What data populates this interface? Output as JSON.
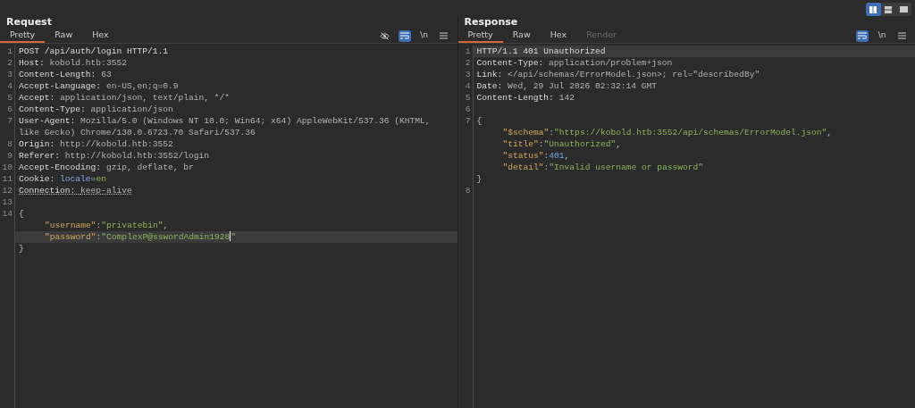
{
  "layout_toggle": [
    {
      "kind": "columns",
      "selected": true
    },
    {
      "kind": "rows",
      "selected": false
    },
    {
      "kind": "single",
      "selected": false
    }
  ],
  "panels": [
    {
      "title": "Request",
      "tabs": [
        {
          "label": "Pretty",
          "selected": true,
          "disabled": false
        },
        {
          "label": "Raw",
          "selected": false,
          "disabled": false
        },
        {
          "label": "Hex",
          "selected": false,
          "disabled": false
        }
      ],
      "toolbar": [
        {
          "kind": "hide",
          "active": false
        },
        {
          "kind": "wrap",
          "active": true
        },
        {
          "kind": "newline",
          "label": "\\n",
          "active": false
        },
        {
          "kind": "menu",
          "active": false
        }
      ],
      "rows": [
        {
          "number": "1",
          "highlighted": false,
          "indented": false,
          "underlined": false,
          "segments": [
            {
              "kind": "plain",
              "text": "POST /api/auth/login HTTP/1.1"
            }
          ]
        },
        {
          "number": "2",
          "highlighted": false,
          "indented": false,
          "underlined": false,
          "segments": [
            {
              "kind": "name",
              "text": "Host: "
            },
            {
              "kind": "value",
              "text": "kobold.htb:3552"
            }
          ]
        },
        {
          "number": "3",
          "highlighted": false,
          "indented": false,
          "underlined": false,
          "segments": [
            {
              "kind": "name",
              "text": "Content-Length: "
            },
            {
              "kind": "value",
              "text": "63"
            }
          ]
        },
        {
          "number": "4",
          "highlighted": false,
          "indented": false,
          "underlined": false,
          "segments": [
            {
              "kind": "name",
              "text": "Accept-Language: "
            },
            {
              "kind": "value",
              "text": "en-US,en;q=0.9"
            }
          ]
        },
        {
          "number": "5",
          "highlighted": false,
          "indented": false,
          "underlined": false,
          "segments": [
            {
              "kind": "name",
              "text": "Accept: "
            },
            {
              "kind": "value",
              "text": "application/json, text/plain, */*"
            }
          ]
        },
        {
          "number": "6",
          "highlighted": false,
          "indented": false,
          "underlined": false,
          "segments": [
            {
              "kind": "name",
              "text": "Content-Type: "
            },
            {
              "kind": "value",
              "text": "application/json"
            }
          ]
        },
        {
          "number": "7",
          "highlighted": false,
          "indented": false,
          "underlined": false,
          "segments": [
            {
              "kind": "name",
              "text": "User-Agent: "
            },
            {
              "kind": "value",
              "text": "Mozilla/5.0 (Windows NT 10.0; Win64; x64) AppleWebKit/537.36 (KHTML,"
            }
          ]
        },
        {
          "highlighted": false,
          "indented": false,
          "underlined": false,
          "segments": [
            {
              "kind": "value",
              "text": "like Gecko) Chrome/130.0.6723.70 Safari/537.36"
            }
          ]
        },
        {
          "number": "8",
          "highlighted": false,
          "indented": false,
          "underlined": false,
          "segments": [
            {
              "kind": "name",
              "text": "Origin: "
            },
            {
              "kind": "value",
              "text": "http://kobold.htb:3552"
            }
          ]
        },
        {
          "number": "9",
          "highlighted": false,
          "indented": false,
          "underlined": false,
          "segments": [
            {
              "kind": "name",
              "text": "Referer: "
            },
            {
              "kind": "value",
              "text": "http://kobold.htb:3552/login"
            }
          ]
        },
        {
          "number": "10",
          "highlighted": false,
          "indented": false,
          "underlined": false,
          "segments": [
            {
              "kind": "name",
              "text": "Accept-Encoding: "
            },
            {
              "kind": "value",
              "text": "gzip, deflate, br"
            }
          ]
        },
        {
          "number": "11",
          "highlighted": false,
          "indented": false,
          "underlined": false,
          "segments": [
            {
              "kind": "name",
              "text": "Cookie: "
            },
            {
              "kind": "param",
              "text": "locale"
            },
            {
              "kind": "punct",
              "text": "="
            },
            {
              "kind": "string",
              "text": "en"
            }
          ]
        },
        {
          "number": "12",
          "highlighted": false,
          "indented": false,
          "underlined": true,
          "segments": [
            {
              "kind": "name",
              "text": "Connection: "
            },
            {
              "kind": "value",
              "text": "keep-alive"
            }
          ]
        },
        {
          "number": "13",
          "segments": []
        },
        {
          "number": "14",
          "highlighted": false,
          "indented": false,
          "segments": [
            {
              "kind": "punct",
              "text": "{"
            }
          ]
        },
        {
          "highlighted": false,
          "indented": true,
          "underlined": false,
          "segments": [
            {
              "kind": "key",
              "text": "\"username\""
            },
            {
              "kind": "punct",
              "text": ":"
            },
            {
              "kind": "string",
              "text": "\"privatebin\""
            },
            {
              "kind": "punct",
              "text": ","
            }
          ]
        },
        {
          "highlighted": true,
          "indented": true,
          "underlined": false,
          "cursor": true,
          "segments": [
            {
              "kind": "key",
              "text": "\"password\""
            },
            {
              "kind": "punct",
              "text": ":"
            },
            {
              "kind": "string",
              "text": "\"ComplexP@sswordAdmin1928"
            },
            {
              "kind": "string",
              "text": "\""
            }
          ]
        },
        {
          "highlighted": false,
          "indented": false,
          "segments": [
            {
              "kind": "punct",
              "text": "}"
            }
          ]
        }
      ]
    },
    {
      "title": "Response",
      "tabs": [
        {
          "label": "Pretty",
          "selected": true,
          "disabled": false
        },
        {
          "label": "Raw",
          "selected": false,
          "disabled": false
        },
        {
          "label": "Hex",
          "selected": false,
          "disabled": false
        },
        {
          "label": "Render",
          "selected": false,
          "disabled": true
        }
      ],
      "toolbar": [
        {
          "kind": "wrap",
          "active": true
        },
        {
          "kind": "newline",
          "label": "\\n",
          "active": false
        },
        {
          "kind": "menu",
          "active": false
        }
      ],
      "rows": [
        {
          "number": "1",
          "highlighted": true,
          "indented": false,
          "underlined": false,
          "segments": [
            {
              "kind": "plain",
              "text": "HTTP/1.1 401 Unauthorized"
            }
          ]
        },
        {
          "number": "2",
          "highlighted": false,
          "indented": false,
          "underlined": false,
          "segments": [
            {
              "kind": "name",
              "text": "Content-Type: "
            },
            {
              "kind": "value",
              "text": "application/problem+json"
            }
          ]
        },
        {
          "number": "3",
          "highlighted": false,
          "indented": false,
          "underlined": false,
          "segments": [
            {
              "kind": "name",
              "text": "Link: "
            },
            {
              "kind": "value",
              "text": "</api/schemas/ErrorModel.json>; rel=\"describedBy\""
            }
          ]
        },
        {
          "number": "4",
          "highlighted": false,
          "indented": false,
          "underlined": false,
          "segments": [
            {
              "kind": "name",
              "text": "Date: "
            },
            {
              "kind": "value",
              "text": "Wed, 29 Jul 2026 02:32:14 GMT"
            }
          ]
        },
        {
          "number": "5",
          "highlighted": false,
          "indented": false,
          "underlined": false,
          "segments": [
            {
              "kind": "name",
              "text": "Content-Length: "
            },
            {
              "kind": "value",
              "text": "142"
            }
          ]
        },
        {
          "number": "6",
          "segments": []
        },
        {
          "number": "7",
          "highlighted": false,
          "indented": false,
          "segments": [
            {
              "kind": "punct",
              "text": "{"
            }
          ]
        },
        {
          "highlighted": false,
          "indented": true,
          "underlined": false,
          "segments": [
            {
              "kind": "key",
              "text": "\"$schema\""
            },
            {
              "kind": "punct",
              "text": ":"
            },
            {
              "kind": "string",
              "text": "\"https://kobold.htb:3552/api/schemas/ErrorModel.json\""
            },
            {
              "kind": "punct",
              "text": ","
            }
          ]
        },
        {
          "highlighted": false,
          "indented": true,
          "underlined": false,
          "segments": [
            {
              "kind": "key",
              "text": "\"title\""
            },
            {
              "kind": "punct",
              "text": ":"
            },
            {
              "kind": "string",
              "text": "\"Unauthorized\""
            },
            {
              "kind": "punct",
              "text": ","
            }
          ]
        },
        {
          "highlighted": false,
          "indented": true,
          "underlined": false,
          "segments": [
            {
              "kind": "key",
              "text": "\"status\""
            },
            {
              "kind": "punct",
              "text": ":"
            },
            {
              "kind": "number",
              "text": "401"
            },
            {
              "kind": "punct",
              "text": ","
            }
          ]
        },
        {
          "highlighted": false,
          "indented": true,
          "underlined": false,
          "segments": [
            {
              "kind": "key",
              "text": "\"detail\""
            },
            {
              "kind": "punct",
              "text": ":"
            },
            {
              "kind": "string",
              "text": "\"Invalid username or password\""
            }
          ]
        },
        {
          "highlighted": false,
          "indented": false,
          "segments": [
            {
              "kind": "punct",
              "text": "}"
            }
          ]
        },
        {
          "number": "8",
          "segments": []
        }
      ]
    }
  ]
}
